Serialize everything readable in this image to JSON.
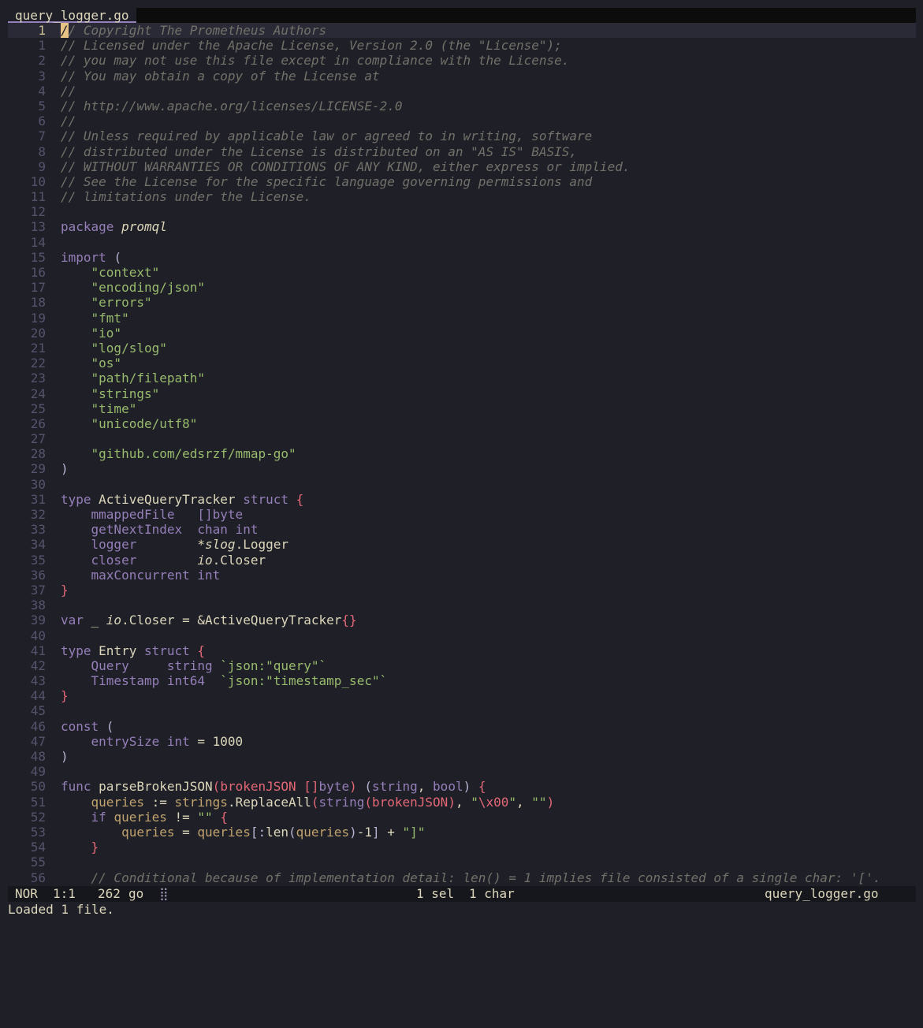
{
  "tab": {
    "filename": "query_logger.go"
  },
  "editor": {
    "lines": [
      {
        "n": "1",
        "current": true,
        "segs": [
          {
            "c": "cursor",
            "t": "/"
          },
          {
            "c": "cm",
            "t": "/ Copyright The Prometheus Authors"
          }
        ]
      },
      {
        "n": "1",
        "segs": [
          {
            "c": "cm",
            "t": "// Licensed under the Apache License, Version 2.0 (the \"License\");"
          }
        ]
      },
      {
        "n": "2",
        "segs": [
          {
            "c": "cm",
            "t": "// you may not use this file except in compliance with the License."
          }
        ]
      },
      {
        "n": "3",
        "segs": [
          {
            "c": "cm",
            "t": "// You may obtain a copy of the License at"
          }
        ]
      },
      {
        "n": "4",
        "segs": [
          {
            "c": "cm",
            "t": "//"
          }
        ]
      },
      {
        "n": "5",
        "segs": [
          {
            "c": "cm",
            "t": "// http://www.apache.org/licenses/LICENSE-2.0"
          }
        ]
      },
      {
        "n": "6",
        "segs": [
          {
            "c": "cm",
            "t": "//"
          }
        ]
      },
      {
        "n": "7",
        "segs": [
          {
            "c": "cm",
            "t": "// Unless required by applicable law or agreed to in writing, software"
          }
        ]
      },
      {
        "n": "8",
        "segs": [
          {
            "c": "cm",
            "t": "// distributed under the License is distributed on an \"AS IS\" BASIS,"
          }
        ]
      },
      {
        "n": "9",
        "segs": [
          {
            "c": "cm",
            "t": "// WITHOUT WARRANTIES OR CONDITIONS OF ANY KIND, either express or implied."
          }
        ]
      },
      {
        "n": "10",
        "segs": [
          {
            "c": "cm",
            "t": "// See the License for the specific language governing permissions and"
          }
        ]
      },
      {
        "n": "11",
        "segs": [
          {
            "c": "cm",
            "t": "// limitations under the License."
          }
        ]
      },
      {
        "n": "12",
        "segs": []
      },
      {
        "n": "13",
        "segs": [
          {
            "c": "kw",
            "t": "package "
          },
          {
            "c": "id it",
            "t": "promql"
          }
        ]
      },
      {
        "n": "14",
        "segs": []
      },
      {
        "n": "15",
        "segs": [
          {
            "c": "kw",
            "t": "import "
          },
          {
            "c": "pm",
            "t": "("
          }
        ]
      },
      {
        "n": "16",
        "segs": [
          {
            "c": "st",
            "t": "    \"context\""
          }
        ]
      },
      {
        "n": "17",
        "segs": [
          {
            "c": "st",
            "t": "    \"encoding/json\""
          }
        ]
      },
      {
        "n": "18",
        "segs": [
          {
            "c": "st",
            "t": "    \"errors\""
          }
        ]
      },
      {
        "n": "19",
        "segs": [
          {
            "c": "st",
            "t": "    \"fmt\""
          }
        ]
      },
      {
        "n": "20",
        "segs": [
          {
            "c": "st",
            "t": "    \"io\""
          }
        ]
      },
      {
        "n": "21",
        "segs": [
          {
            "c": "st",
            "t": "    \"log/slog\""
          }
        ]
      },
      {
        "n": "22",
        "segs": [
          {
            "c": "st",
            "t": "    \"os\""
          }
        ]
      },
      {
        "n": "23",
        "segs": [
          {
            "c": "st",
            "t": "    \"path/filepath\""
          }
        ]
      },
      {
        "n": "24",
        "segs": [
          {
            "c": "st",
            "t": "    \"strings\""
          }
        ]
      },
      {
        "n": "25",
        "segs": [
          {
            "c": "st",
            "t": "    \"time\""
          }
        ]
      },
      {
        "n": "26",
        "segs": [
          {
            "c": "st",
            "t": "    \"unicode/utf8\""
          }
        ]
      },
      {
        "n": "27",
        "segs": []
      },
      {
        "n": "28",
        "segs": [
          {
            "c": "st",
            "t": "    \"github.com/edsrzf/mmap-go\""
          }
        ]
      },
      {
        "n": "29",
        "segs": [
          {
            "c": "pm",
            "t": ")"
          }
        ]
      },
      {
        "n": "30",
        "segs": []
      },
      {
        "n": "31",
        "segs": [
          {
            "c": "kw",
            "t": "type "
          },
          {
            "c": "id",
            "t": "ActiveQueryTracker "
          },
          {
            "c": "kw",
            "t": "struct "
          },
          {
            "c": "br",
            "t": "{"
          }
        ]
      },
      {
        "n": "32",
        "segs": [
          {
            "c": "kw",
            "t": "    mmappedFile   "
          },
          {
            "c": "kw",
            "t": "[]byte"
          }
        ]
      },
      {
        "n": "33",
        "segs": [
          {
            "c": "kw",
            "t": "    getNextIndex  "
          },
          {
            "c": "kw",
            "t": "chan int"
          }
        ]
      },
      {
        "n": "34",
        "segs": [
          {
            "c": "kw",
            "t": "    logger        "
          },
          {
            "c": "id",
            "t": "*"
          },
          {
            "c": "id it",
            "t": "slog"
          },
          {
            "c": "id",
            "t": ".Logger"
          }
        ]
      },
      {
        "n": "35",
        "segs": [
          {
            "c": "kw",
            "t": "    closer        "
          },
          {
            "c": "id it",
            "t": "io"
          },
          {
            "c": "id",
            "t": ".Closer"
          }
        ]
      },
      {
        "n": "36",
        "segs": [
          {
            "c": "kw",
            "t": "    maxConcurrent "
          },
          {
            "c": "kw",
            "t": "int"
          }
        ]
      },
      {
        "n": "37",
        "segs": [
          {
            "c": "br",
            "t": "}"
          }
        ]
      },
      {
        "n": "38",
        "segs": []
      },
      {
        "n": "39",
        "segs": [
          {
            "c": "kw",
            "t": "var "
          },
          {
            "c": "id",
            "t": "_ "
          },
          {
            "c": "id it",
            "t": "io"
          },
          {
            "c": "id",
            "t": ".Closer = &ActiveQueryTracker"
          },
          {
            "c": "br",
            "t": "{}"
          }
        ]
      },
      {
        "n": "40",
        "segs": []
      },
      {
        "n": "41",
        "segs": [
          {
            "c": "kw",
            "t": "type "
          },
          {
            "c": "id",
            "t": "Entry "
          },
          {
            "c": "kw",
            "t": "struct "
          },
          {
            "c": "br",
            "t": "{"
          }
        ]
      },
      {
        "n": "42",
        "segs": [
          {
            "c": "kw",
            "t": "    Query     string "
          },
          {
            "c": "st",
            "t": "`json:\"query\"`"
          }
        ]
      },
      {
        "n": "43",
        "segs": [
          {
            "c": "kw",
            "t": "    Timestamp int64  "
          },
          {
            "c": "st",
            "t": "`json:\"timestamp_sec\"`"
          }
        ]
      },
      {
        "n": "44",
        "segs": [
          {
            "c": "br",
            "t": "}"
          }
        ]
      },
      {
        "n": "45",
        "segs": []
      },
      {
        "n": "46",
        "segs": [
          {
            "c": "kw",
            "t": "const "
          },
          {
            "c": "pm",
            "t": "("
          }
        ]
      },
      {
        "n": "47",
        "segs": [
          {
            "c": "kw",
            "t": "    entrySize int "
          },
          {
            "c": "id",
            "t": "= "
          },
          {
            "c": "id",
            "t": "1000"
          }
        ]
      },
      {
        "n": "48",
        "segs": [
          {
            "c": "pm",
            "t": ")"
          }
        ]
      },
      {
        "n": "49",
        "segs": []
      },
      {
        "n": "50",
        "segs": [
          {
            "c": "kw",
            "t": "func "
          },
          {
            "c": "id",
            "t": "parseBrokenJSON"
          },
          {
            "c": "br",
            "t": "("
          },
          {
            "c": "br",
            "t": "brokenJSON []"
          },
          {
            "c": "kw",
            "t": "byte"
          },
          {
            "c": "br",
            "t": ")"
          },
          {
            "c": "pm",
            "t": " ("
          },
          {
            "c": "kw",
            "t": "string"
          },
          {
            "c": "id",
            "t": ", "
          },
          {
            "c": "kw",
            "t": "bool"
          },
          {
            "c": "pm",
            "t": ") "
          },
          {
            "c": "br",
            "t": "{"
          }
        ]
      },
      {
        "n": "51",
        "segs": [
          {
            "c": "pr",
            "t": "    queries "
          },
          {
            "c": "id",
            "t": ":= "
          },
          {
            "c": "pr",
            "t": "strings"
          },
          {
            "c": "id",
            "t": ".ReplaceAll"
          },
          {
            "c": "br",
            "t": "("
          },
          {
            "c": "kw",
            "t": "string"
          },
          {
            "c": "br",
            "t": "("
          },
          {
            "c": "br",
            "t": "brokenJSON"
          },
          {
            "c": "br",
            "t": ")"
          },
          {
            "c": "id",
            "t": ", "
          },
          {
            "c": "st",
            "t": "\""
          },
          {
            "c": "br",
            "t": "\\x00"
          },
          {
            "c": "st",
            "t": "\""
          },
          {
            "c": "id",
            "t": ", "
          },
          {
            "c": "st",
            "t": "\"\""
          },
          {
            "c": "br",
            "t": ")"
          }
        ]
      },
      {
        "n": "52",
        "segs": [
          {
            "c": "kw",
            "t": "    if "
          },
          {
            "c": "pr",
            "t": "queries "
          },
          {
            "c": "id",
            "t": "!= "
          },
          {
            "c": "st",
            "t": "\"\" "
          },
          {
            "c": "br",
            "t": "{"
          }
        ]
      },
      {
        "n": "53",
        "segs": [
          {
            "c": "pr",
            "t": "        queries "
          },
          {
            "c": "id",
            "t": "= "
          },
          {
            "c": "pr",
            "t": "queries"
          },
          {
            "c": "pm",
            "t": "[:"
          },
          {
            "c": "id",
            "t": "len"
          },
          {
            "c": "pm",
            "t": "("
          },
          {
            "c": "pr",
            "t": "queries"
          },
          {
            "c": "pm",
            "t": ")"
          },
          {
            "c": "id",
            "t": "-1"
          },
          {
            "c": "pm",
            "t": "] "
          },
          {
            "c": "id",
            "t": "+ "
          },
          {
            "c": "st",
            "t": "\"]\""
          }
        ]
      },
      {
        "n": "54",
        "segs": [
          {
            "c": "br",
            "t": "    }"
          }
        ]
      },
      {
        "n": "55",
        "segs": []
      },
      {
        "n": "56",
        "segs": [
          {
            "c": "cm",
            "t": "    // Conditional because of implementation detail: len() = 1 implies file consisted of a single char: '['."
          }
        ]
      }
    ]
  },
  "status": {
    "mode": "NOR",
    "position": "1:1",
    "total_lines": "262",
    "language": "go",
    "diag_icon": "⣿",
    "selections": "1 sel",
    "chars": "1 char",
    "filename": "query_logger.go"
  },
  "message": "Loaded 1 file."
}
